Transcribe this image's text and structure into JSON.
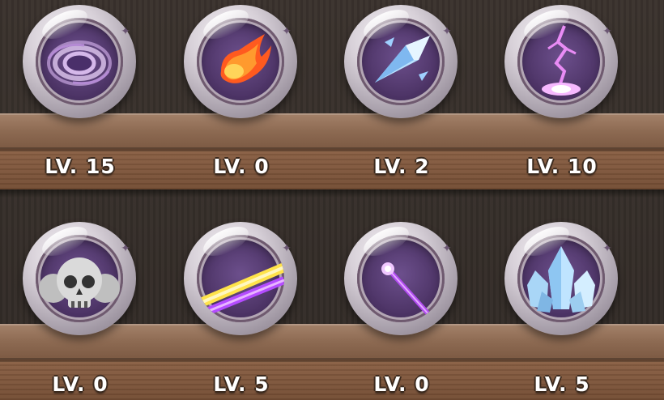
{
  "skills": [
    {
      "name": "Void Vortex",
      "icon": "vortex-icon",
      "level": "LV. 15"
    },
    {
      "name": "Fireball",
      "icon": "fireball-icon",
      "level": "LV. 0"
    },
    {
      "name": "Ice Shard",
      "icon": "ice-shard-icon",
      "level": "LV. 2"
    },
    {
      "name": "Lightning Strike",
      "icon": "lightning-icon",
      "level": "LV. 10"
    },
    {
      "name": "Skull Curse",
      "icon": "skull-icon",
      "level": "LV. 0"
    },
    {
      "name": "Beam",
      "icon": "beam-icon",
      "level": "LV. 5"
    },
    {
      "name": "Magic Wand",
      "icon": "wand-icon",
      "level": "LV. 0"
    },
    {
      "name": "Crystal Cluster",
      "icon": "crystal-icon",
      "level": "LV. 5"
    }
  ],
  "colors": {
    "orb_inner": "#4d3466",
    "shelf_top": "#a4826a",
    "shelf_front": "#7c5a43",
    "background": "#342c28",
    "label_text": "#ffffff"
  }
}
